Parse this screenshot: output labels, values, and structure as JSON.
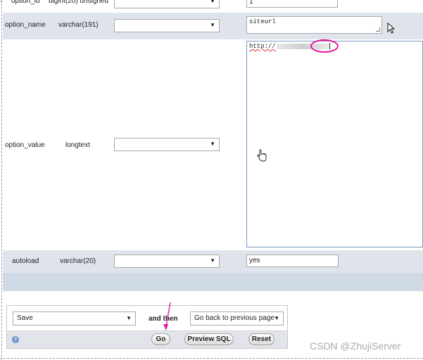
{
  "rows": [
    {
      "name": "option_id",
      "type": "bigint(20) unsigned",
      "value": "1"
    },
    {
      "name": "option_name",
      "type": "varchar(191)",
      "value": "siteurl"
    },
    {
      "name": "option_value",
      "type": "longtext",
      "value_prefix": "http://"
    },
    {
      "name": "autoload",
      "type": "varchar(20)",
      "value": "yes"
    }
  ],
  "actions": {
    "action_select_value": "Save",
    "and_then_label": "and then",
    "after_select_value": "Go back to previous page",
    "go_label": "Go",
    "preview_label": "Preview SQL",
    "reset_label": "Reset",
    "help_glyph": "?"
  },
  "icons": {
    "dropdown": "triangle-down-icon",
    "help": "help-icon",
    "pointer_cursor": "arrow-cursor-icon",
    "hand_cursor": "hand-cursor-icon"
  },
  "colors": {
    "row_shaded": "#dfe4ec",
    "annotation": "#e6179b"
  },
  "watermark": "CSDN @ZhujiServer"
}
